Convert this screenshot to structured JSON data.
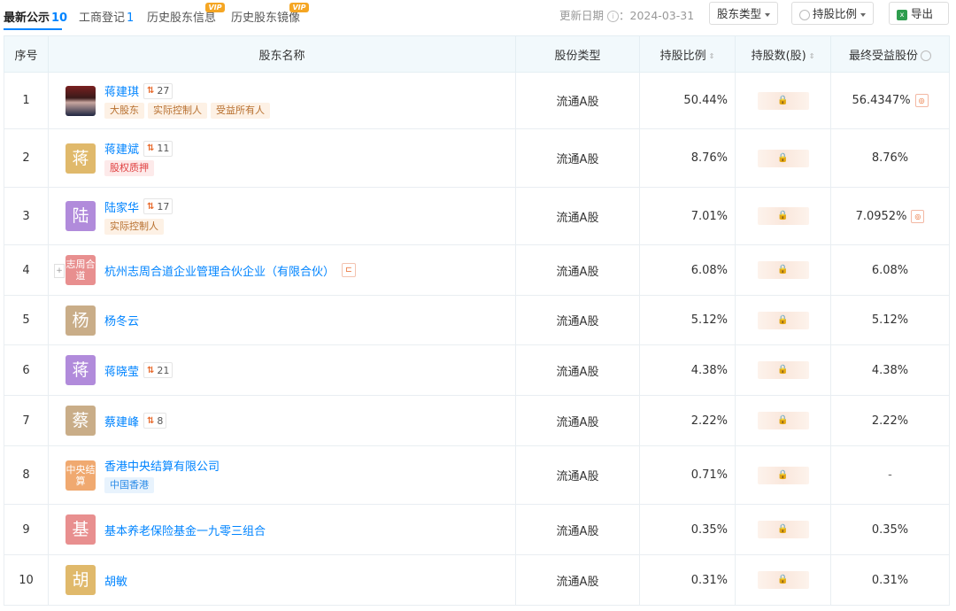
{
  "tabs": [
    {
      "label": "最新公示",
      "count": "10",
      "vip": false
    },
    {
      "label": "工商登记",
      "count": "1",
      "vip": false
    },
    {
      "label": "历史股东信息",
      "count": "",
      "vip": true,
      "vip_label": "VIP"
    },
    {
      "label": "历史股东镜像",
      "count": "",
      "vip": true,
      "vip_label": "VIP"
    }
  ],
  "update": {
    "label": "更新日期",
    "info": "i",
    "value": "：2024-03-31"
  },
  "buttons": {
    "holder_type": "股东类型",
    "holding_ratio": "持股比例",
    "export": "导出",
    "export_icon": "x"
  },
  "columns": [
    "序号",
    "股东名称",
    "股份类型",
    "持股比例",
    "持股数(股)",
    "最终受益股份"
  ],
  "sort_symbol": "⇕",
  "locked_glyph": "🔒",
  "colors": {
    "accent": "#0084ff",
    "header_bg": "#f2f9fc",
    "relation": "#e86a2c"
  },
  "rows": [
    {
      "no": "1",
      "name": "蒋建琪",
      "avatar_text": "",
      "avatar_type": "photo",
      "avatar_color": "#7a2020",
      "rel_icon": "⇅",
      "rel_count": "27",
      "tags": [
        {
          "text": "大股东",
          "style": "brown"
        },
        {
          "text": "实际控制人",
          "style": "brown"
        },
        {
          "text": "受益所有人",
          "style": "brown"
        }
      ],
      "share_type": "流通A股",
      "ratio": "50.44%",
      "final": "56.4347%",
      "chain": true,
      "expand": false,
      "tree": false
    },
    {
      "no": "2",
      "name": "蒋建斌",
      "avatar_text": "蒋",
      "avatar_type": "text",
      "avatar_color": "#e0b96b",
      "rel_icon": "⇅",
      "rel_count": "11",
      "tags": [
        {
          "text": "股权质押",
          "style": "red"
        }
      ],
      "share_type": "流通A股",
      "ratio": "8.76%",
      "final": "8.76%",
      "chain": false,
      "expand": false,
      "tree": false
    },
    {
      "no": "3",
      "name": "陆家华",
      "avatar_text": "陆",
      "avatar_type": "text",
      "avatar_color": "#b18bdb",
      "rel_icon": "⇅",
      "rel_count": "17",
      "tags": [
        {
          "text": "实际控制人",
          "style": "brown"
        }
      ],
      "share_type": "流通A股",
      "ratio": "7.01%",
      "final": "7.0952%",
      "chain": true,
      "expand": false,
      "tree": false
    },
    {
      "no": "4",
      "name": "杭州志周合道企业管理合伙企业（有限合伙）",
      "avatar_text": "志周合道",
      "avatar_type": "small",
      "avatar_color": "#e88f8f",
      "rel_icon": "",
      "rel_count": "",
      "tags": [],
      "share_type": "流通A股",
      "ratio": "6.08%",
      "final": "6.08%",
      "chain": false,
      "expand": true,
      "tree": true
    },
    {
      "no": "5",
      "name": "杨冬云",
      "avatar_text": "杨",
      "avatar_type": "text",
      "avatar_color": "#c9ad88",
      "rel_icon": "",
      "rel_count": "",
      "tags": [],
      "share_type": "流通A股",
      "ratio": "5.12%",
      "final": "5.12%",
      "chain": false,
      "expand": false,
      "tree": false
    },
    {
      "no": "6",
      "name": "蒋晓莹",
      "avatar_text": "蒋",
      "avatar_type": "text",
      "avatar_color": "#b18bdb",
      "rel_icon": "⇅",
      "rel_count": "21",
      "tags": [],
      "share_type": "流通A股",
      "ratio": "4.38%",
      "final": "4.38%",
      "chain": false,
      "expand": false,
      "tree": false
    },
    {
      "no": "7",
      "name": "蔡建峰",
      "avatar_text": "蔡",
      "avatar_type": "text",
      "avatar_color": "#c9ad88",
      "rel_icon": "⇅",
      "rel_count": "8",
      "tags": [],
      "share_type": "流通A股",
      "ratio": "2.22%",
      "final": "2.22%",
      "chain": false,
      "expand": false,
      "tree": false
    },
    {
      "no": "8",
      "name": "香港中央结算有限公司",
      "avatar_text": "中央结算",
      "avatar_type": "small",
      "avatar_color": "#f0a970",
      "rel_icon": "",
      "rel_count": "",
      "tags": [
        {
          "text": "中国香港",
          "style": "blue"
        }
      ],
      "share_type": "流通A股",
      "ratio": "0.71%",
      "final": "-",
      "chain": false,
      "expand": false,
      "tree": false
    },
    {
      "no": "9",
      "name": "基本养老保险基金一九零三组合",
      "avatar_text": "基",
      "avatar_type": "text",
      "avatar_color": "#e88f8f",
      "rel_icon": "",
      "rel_count": "",
      "tags": [],
      "share_type": "流通A股",
      "ratio": "0.35%",
      "final": "0.35%",
      "chain": false,
      "expand": false,
      "tree": false
    },
    {
      "no": "10",
      "name": "胡敏",
      "avatar_text": "胡",
      "avatar_type": "text",
      "avatar_color": "#e0b96b",
      "rel_icon": "",
      "rel_count": "",
      "tags": [],
      "share_type": "流通A股",
      "ratio": "0.31%",
      "final": "0.31%",
      "chain": false,
      "expand": false,
      "tree": false
    }
  ]
}
